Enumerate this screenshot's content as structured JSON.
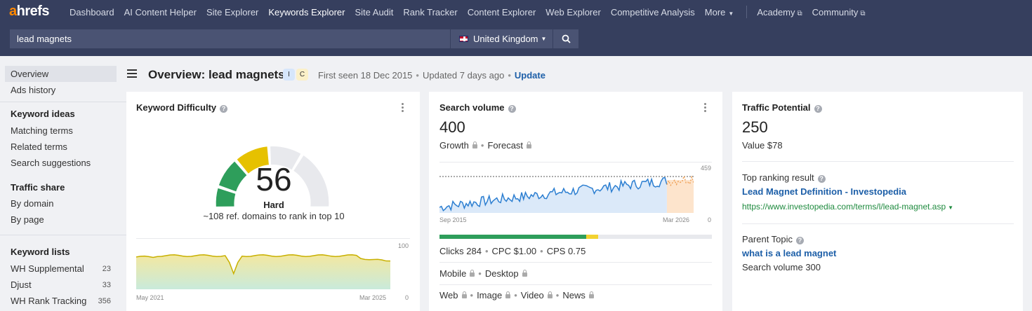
{
  "nav": {
    "logo_a": "a",
    "logo_rest": "hrefs",
    "items": [
      "Dashboard",
      "AI Content Helper",
      "Site Explorer",
      "Keywords Explorer",
      "Site Audit",
      "Rank Tracker",
      "Content Explorer",
      "Web Explorer",
      "Competitive Analysis"
    ],
    "more": "More",
    "academy": "Academy",
    "community": "Community"
  },
  "search": {
    "value": "lead magnets",
    "country": "United Kingdom"
  },
  "sidebar": {
    "overview": "Overview",
    "ads_history": "Ads history",
    "keyword_ideas_head": "Keyword ideas",
    "matching_terms": "Matching terms",
    "related_terms": "Related terms",
    "search_suggestions": "Search suggestions",
    "traffic_share_head": "Traffic share",
    "by_domain": "By domain",
    "by_page": "By page",
    "keyword_lists_head": "Keyword lists",
    "lists": [
      {
        "label": "WH Supplemental",
        "count": "23"
      },
      {
        "label": "Djust",
        "count": "33"
      },
      {
        "label": "WH Rank Tracking",
        "count": "356"
      }
    ]
  },
  "header": {
    "title": "Overview: lead magnets",
    "intent_i": "I",
    "intent_c": "C",
    "first_seen": "First seen 18 Dec 2015",
    "updated": "Updated 7 days ago",
    "update_link": "Update"
  },
  "kd": {
    "title": "Keyword Difficulty",
    "score": "56",
    "level": "Hard",
    "note": "~108 ref. domains to rank in top 10",
    "chart": {
      "y_max": "100",
      "y_min": "0",
      "x_start": "May 2021",
      "x_end": "Mar 2025"
    }
  },
  "sv": {
    "title": "Search volume",
    "value": "400",
    "growth": "Growth",
    "forecast": "Forecast",
    "chart": {
      "y_max": "459",
      "y_min": "0",
      "x_start": "Sep 2015",
      "x_end": "Mar 2026"
    },
    "clicks": "Clicks 284",
    "cpc": "CPC $1.00",
    "cps": "CPS 0.75",
    "mobile": "Mobile",
    "desktop": "Desktop",
    "web": "Web",
    "image": "Image",
    "video": "Video",
    "news": "News"
  },
  "tp": {
    "title": "Traffic Potential",
    "value": "250",
    "value_usd": "Value $78",
    "top_result_label": "Top ranking result",
    "top_result_title": "Lead Magnet Definition - Investopedia",
    "top_result_url": "https://www.investopedia.com/terms/l/lead-magnet.asp",
    "parent_topic_label": "Parent Topic",
    "parent_topic": "what is a lead magnet",
    "parent_volume": "Search volume 300"
  },
  "colors": {
    "nav_bg": "#363f5e",
    "link": "#1d5fa8",
    "green": "#2e9e5b",
    "yellow": "#e6c100",
    "line_blue": "#2d7fd1",
    "forecast_orange": "#f0a35a"
  }
}
